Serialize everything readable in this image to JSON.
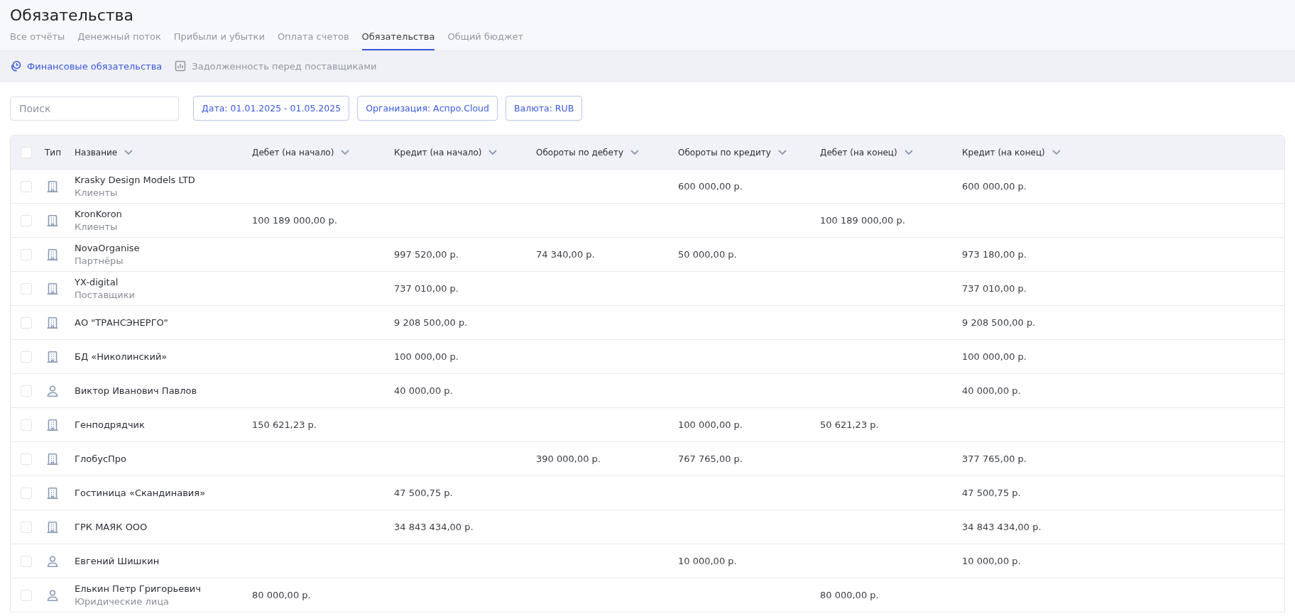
{
  "page": {
    "title": "Обязательства"
  },
  "tabs": [
    {
      "label": "Все отчёты",
      "selected": false
    },
    {
      "label": "Денежный поток",
      "selected": false
    },
    {
      "label": "Прибыли и убытки",
      "selected": false
    },
    {
      "label": "Оплата счетов",
      "selected": false
    },
    {
      "label": "Обязательства",
      "selected": true
    },
    {
      "label": "Общий бюджет",
      "selected": false
    }
  ],
  "subtabs": [
    {
      "label": "Финансовые обязательства",
      "selected": true,
      "kind": "clock"
    },
    {
      "label": "Задолженность перед поставщиками",
      "selected": false,
      "kind": "chart"
    }
  ],
  "search": {
    "placeholder": "Поиск"
  },
  "filters": [
    "Дата: 01.01.2025 - 01.05.2025",
    "Организация: Аспро.Cloud",
    "Валюта: RUB"
  ],
  "table": {
    "columns": [
      "Тип",
      "Название",
      "Дебет (на начало)",
      "Кредит (на начало)",
      "Обороты по дебету",
      "Обороты по кредиту",
      "Дебет (на конец)",
      "Кредит (на конец)"
    ],
    "all_checked": false,
    "rows": [
      {
        "kind": "company",
        "checked": false,
        "name": "Krasky Design Models LTD",
        "group": "Клиенты",
        "credit_turnover": "600 000,00 р.",
        "credit_end": "600 000,00 р."
      },
      {
        "kind": "company",
        "checked": false,
        "name": "KronKoron",
        "group": "Клиенты",
        "debit_start": "100 189 000,00 р.",
        "debit_end": "100 189 000,00 р."
      },
      {
        "kind": "company",
        "checked": false,
        "name": "NovaOrganise",
        "group": "Партнёры",
        "credit_start": "997 520,00 р.",
        "debit_turnover": "74 340,00 р.",
        "credit_turnover": "50 000,00 р.",
        "credit_end": "973 180,00 р."
      },
      {
        "kind": "company",
        "checked": false,
        "name": "YX-digital",
        "group": "Поставщики",
        "credit_start": "737 010,00 р.",
        "credit_end": "737 010,00 р."
      },
      {
        "kind": "company",
        "checked": false,
        "name": "АО \"ТРАНСЭНЕРГО\"",
        "credit_start": "9 208 500,00 р.",
        "credit_end": "9 208 500,00 р."
      },
      {
        "kind": "company",
        "checked": false,
        "name": "БД «Николинский»",
        "credit_start": "100 000,00 р.",
        "credit_end": "100 000,00 р."
      },
      {
        "kind": "person",
        "checked": false,
        "name": "Виктор Иванович Павлов",
        "credit_start": "40 000,00 р.",
        "credit_end": "40 000,00 р."
      },
      {
        "kind": "company",
        "checked": false,
        "name": "Генподрядчик",
        "debit_start": "150 621,23 р.",
        "credit_turnover": "100 000,00 р.",
        "debit_end": "50 621,23 р."
      },
      {
        "kind": "company",
        "checked": false,
        "name": "ГлобусПро",
        "debit_turnover": "390 000,00 р.",
        "credit_turnover": "767 765,00 р.",
        "credit_end": "377 765,00 р."
      },
      {
        "kind": "company",
        "checked": false,
        "name": "Гостиница «Скандинавия»",
        "credit_start": "47 500,75 р.",
        "credit_end": "47 500,75 р."
      },
      {
        "kind": "company",
        "checked": false,
        "name": "ГРК МАЯК ООО",
        "credit_start": "34 843 434,00 р.",
        "credit_end": "34 843 434,00 р."
      },
      {
        "kind": "person",
        "checked": false,
        "name": "Евгений Шишкин",
        "credit_turnover": "10 000,00 р.",
        "credit_end": "10 000,00 р."
      },
      {
        "kind": "person",
        "checked": false,
        "name": "Елькин Петр Григорьевич",
        "group": "Юридические лица",
        "debit_start": "80 000,00 р.",
        "debit_end": "80 000,00 р."
      }
    ]
  }
}
